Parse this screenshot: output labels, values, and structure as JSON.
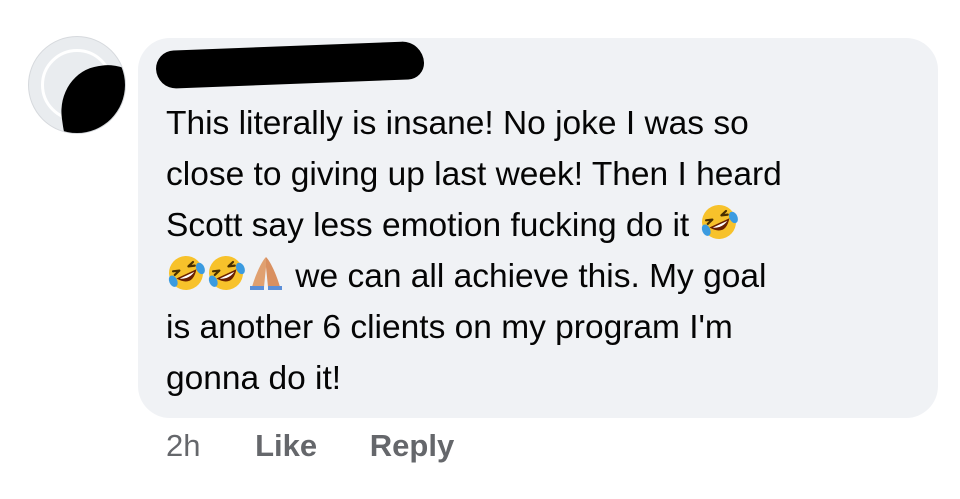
{
  "comment": {
    "text_lines": [
      [
        "This literally is insane! No joke I was so"
      ],
      [
        "close to giving up last week! Then I heard"
      ],
      [
        "Scott say less emotion fucking do it "
      ],
      [
        "",
        " we can all achieve this. My goal"
      ],
      [
        "is another 6 clients on my program I'm"
      ],
      [
        "gonna do it!"
      ]
    ],
    "emojis": [
      "rolling-on-floor-laughing-icon",
      "rolling-on-floor-laughing-icon",
      "rolling-on-floor-laughing-icon",
      "folded-hands-icon"
    ],
    "timestamp": "2h",
    "like_label": "Like",
    "reply_label": "Reply"
  },
  "colors": {
    "bubble_bg": "#f0f2f5",
    "text": "#050505",
    "meta_text": "#65676b",
    "emoji_face": "#f7c22b",
    "tears": "#3b9be0"
  }
}
